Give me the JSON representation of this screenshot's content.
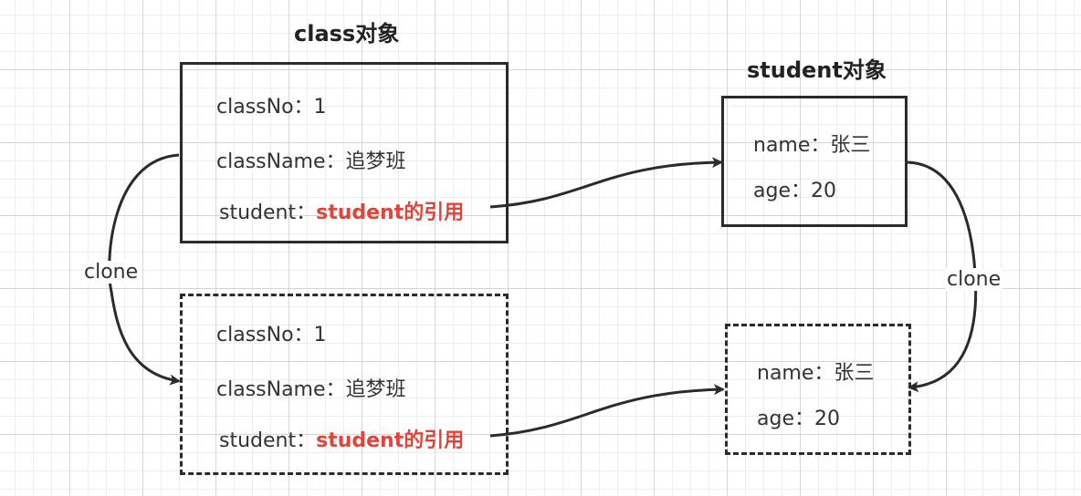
{
  "titles": {
    "class": "class对象",
    "student": "student对象"
  },
  "class_original": {
    "classNo": "classNo：1",
    "className": "className：追梦班",
    "student_label": "student：",
    "student_ref": "student的引用"
  },
  "class_clone": {
    "classNo": "classNo：1",
    "className": "className：追梦班",
    "student_label": "student：",
    "student_ref": "student的引用"
  },
  "student_original": {
    "name": "name：张三",
    "age": "age：20"
  },
  "student_clone": {
    "name": "name：张三",
    "age": "age：20"
  },
  "edge_labels": {
    "left_clone": "clone",
    "right_clone": "clone"
  },
  "colors": {
    "border": "#2b2b2b",
    "reference_text": "#e0443a"
  }
}
